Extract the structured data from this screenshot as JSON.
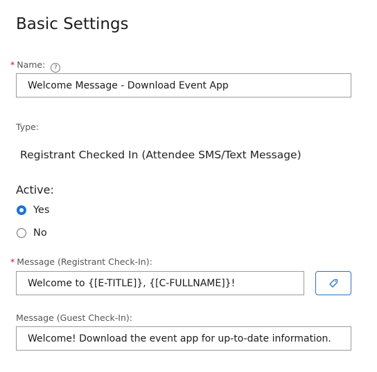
{
  "heading": "Basic Settings",
  "name_field": {
    "required_mark": "*",
    "label": "Name:",
    "help_glyph": "?",
    "value": "Welcome Message - Download Event App"
  },
  "type_field": {
    "label": "Type:",
    "value": "Registrant Checked In (Attendee SMS/Text Message)"
  },
  "active_field": {
    "label": "Active:",
    "options": [
      {
        "label": "Yes",
        "selected": true
      },
      {
        "label": "No",
        "selected": false
      }
    ]
  },
  "registrant_message": {
    "required_mark": "*",
    "label": "Message (Registrant Check-In):",
    "value": "Welcome to {[E-TITLE]}, {[C-FULLNAME]}!",
    "tag_button_icon": "tag-icon"
  },
  "guest_message": {
    "label": "Message (Guest Check-In):",
    "value": "Welcome! Download the event app for up-to-date information."
  },
  "colors": {
    "accent": "#1a73d9",
    "required": "#c8102e",
    "button_border": "#2d6fb8"
  }
}
